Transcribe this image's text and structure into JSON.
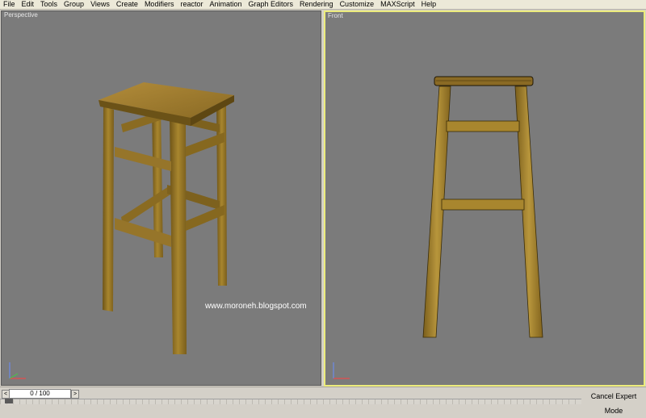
{
  "menu": [
    "File",
    "Edit",
    "Tools",
    "Group",
    "Views",
    "Create",
    "Modifiers",
    "reactor",
    "Animation",
    "Graph Editors",
    "Rendering",
    "Customize",
    "MAXScript",
    "Help"
  ],
  "viewports": {
    "perspective": {
      "label": "Perspective",
      "watermark": "www.moroneh.blogspot.com"
    },
    "front": {
      "label": "Front"
    }
  },
  "status": {
    "frame_counter": "0 / 100",
    "nav_left": "<",
    "nav_right": ">",
    "expert_button": "Cancel Expert Mode"
  },
  "colors": {
    "viewport_bg": "#7b7b7b",
    "active_viewport_border": "#ecec7c",
    "wood": "#9c7a2a"
  },
  "icons": [
    "axis-tripod-icon"
  ]
}
